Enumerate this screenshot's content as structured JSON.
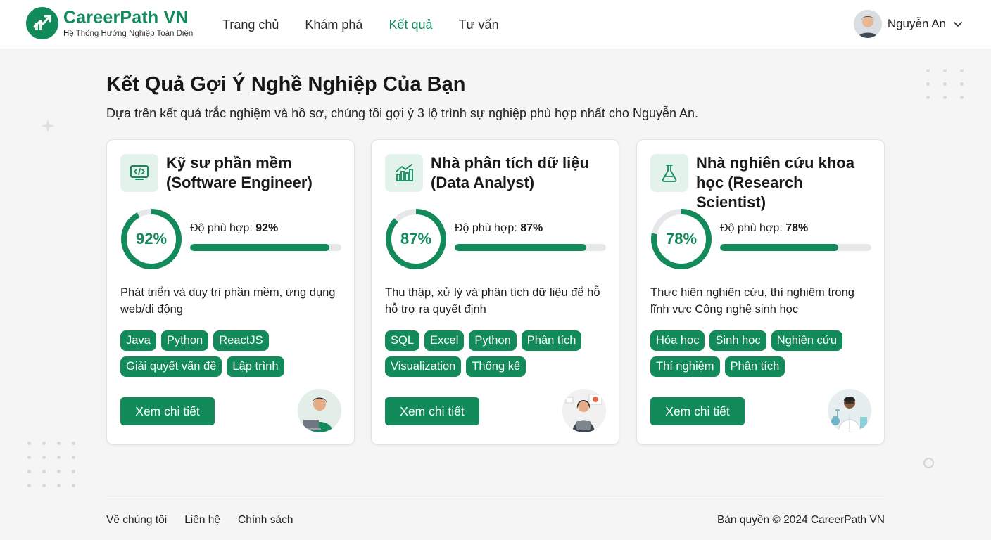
{
  "brand": {
    "name": "CareerPath VN",
    "tagline": "Hệ Thống Hướng Nghiệp Toàn Diện",
    "color": "#138a5a"
  },
  "nav": {
    "items": [
      {
        "label": "Trang chủ"
      },
      {
        "label": "Khám phá"
      },
      {
        "label": "Kết quả"
      },
      {
        "label": "Tư vấn"
      }
    ],
    "active": "Kết quả"
  },
  "user": {
    "name": "Nguyễn An"
  },
  "page": {
    "title": "Kết Quả Gợi Ý Nghề Nghiệp Của Bạn",
    "subtitle": "Dựa trên kết quả trắc nghiệm và hồ sơ, chúng tôi gợi ý 3 lộ trình sự nghiệp phù hợp nhất cho Nguyễn An."
  },
  "cards": [
    {
      "title": "Kỹ sư phần mềm (Software Engineer)",
      "icon": "code-monitor-icon",
      "percent_text": "92%",
      "fit_prefix": "Độ phù hợp:",
      "fit_value": "92%",
      "fit": 0.92,
      "description": "Phát triển và duy trì phần mềm, ứng dụng web/di động",
      "tags": [
        "Java",
        "Python",
        "ReactJS",
        "Giải quyết vấn đề",
        "Lập trình"
      ],
      "button": "Xem chi tiết",
      "illustration": "software-engineer-illustration"
    },
    {
      "title": "Nhà phân tích dữ liệu (Data Analyst)",
      "icon": "chart-icon",
      "percent_text": "87%",
      "fit_prefix": "Độ phù hợp:",
      "fit_value": "87%",
      "fit": 0.87,
      "description": "Thu thập, xử lý và phân tích dữ liệu để hỗ hỗ trợ ra quyết định",
      "tags": [
        "SQL",
        "Excel",
        "Python",
        "Phân tích",
        "Visualization",
        "Thống kê"
      ],
      "button": "Xem chi tiết",
      "illustration": "data-analyst-illustration"
    },
    {
      "title": "Nhà nghiên cứu khoa học (Research Scientist)",
      "icon": "flask-icon",
      "percent_text": "78%",
      "fit_prefix": "Độ phù hợp:",
      "fit_value": "78%",
      "fit": 0.78,
      "description": "Thực hiện nghiên cứu, thí nghiệm trong lĩnh vực Công nghệ sinh học",
      "tags": [
        "Hóa học",
        "Sinh học",
        "Nghiên cứu",
        "Thí nghiệm",
        "Phân tích"
      ],
      "button": "Xem chi tiết",
      "illustration": "research-scientist-illustration"
    }
  ],
  "footer": {
    "links": [
      "Về chúng tôi",
      "Liên hệ",
      "Chính sách"
    ],
    "copyright": "Bản quyền © 2024 CareerPath VN"
  }
}
